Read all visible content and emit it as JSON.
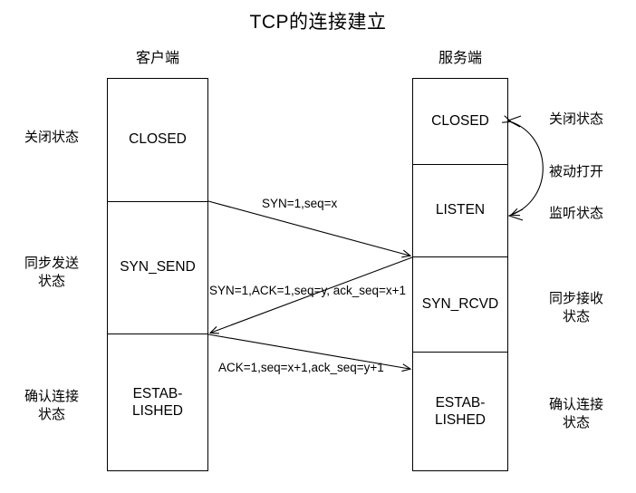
{
  "title": "TCP的连接建立",
  "columns": {
    "client": {
      "header": "客户端",
      "states": [
        {
          "name": "CLOSED",
          "note": "关闭状态"
        },
        {
          "name": "SYN_SEND",
          "note": "同步发送\n状态"
        },
        {
          "name": "ESTAB-\nLISHED",
          "note": "确认连接\n状态"
        }
      ]
    },
    "server": {
      "header": "服务端",
      "states": [
        {
          "name": "CLOSED",
          "note": "关闭状态"
        },
        {
          "name": "LISTEN",
          "note": "监听状态"
        },
        {
          "name": "SYN_RCVD",
          "note": "同步接收\n状态"
        },
        {
          "name": "ESTAB-\nLISHED",
          "note": "确认连接\n状态"
        }
      ],
      "transition_note": "被动打开"
    }
  },
  "messages": [
    {
      "id": "syn",
      "label": "SYN=1,seq=x",
      "direction": "client-to-server"
    },
    {
      "id": "syn-ack",
      "label": "SYN=1,ACK=1,seq=y, ack_seq=x+1",
      "direction": "server-to-client"
    },
    {
      "id": "ack",
      "label": "ACK=1,seq=x+1,ack_seq=y+1",
      "direction": "client-to-server"
    }
  ],
  "colors": {
    "stroke": "#000000",
    "background": "#ffffff",
    "text": "#000000"
  }
}
